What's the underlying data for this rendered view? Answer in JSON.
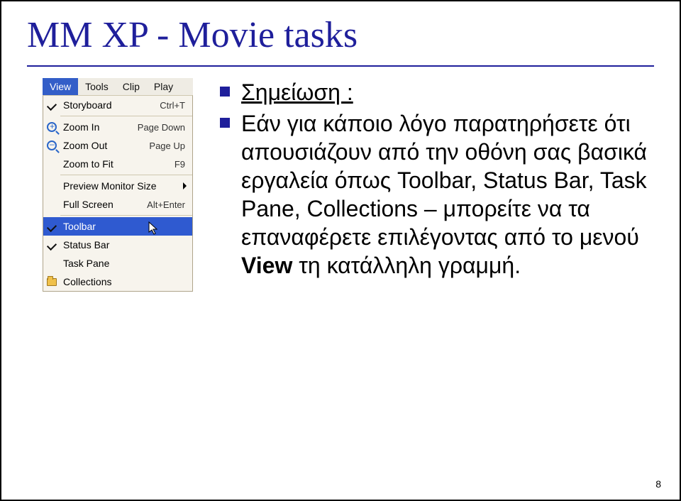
{
  "title": "ΜΜ XP - Movie tasks",
  "menubar": {
    "view": "View",
    "tools": "Tools",
    "clip": "Clip",
    "play": "Play"
  },
  "menu": {
    "storyboard": {
      "label": "Storyboard",
      "shortcut": "Ctrl+T"
    },
    "zoom_in": {
      "label": "Zoom In",
      "shortcut": "Page Down"
    },
    "zoom_out": {
      "label": "Zoom Out",
      "shortcut": "Page Up"
    },
    "zoom_fit": {
      "label": "Zoom to Fit",
      "shortcut": "F9"
    },
    "preview_size": {
      "label": "Preview Monitor Size",
      "shortcut": ""
    },
    "full_screen": {
      "label": "Full Screen",
      "shortcut": "Alt+Enter"
    },
    "toolbar": {
      "label": "Toolbar",
      "shortcut": ""
    },
    "status_bar": {
      "label": "Status Bar",
      "shortcut": ""
    },
    "task_pane": {
      "label": "Task Pane",
      "shortcut": ""
    },
    "collections": {
      "label": "Collections",
      "shortcut": ""
    }
  },
  "body": {
    "note_label": "Σημείωση :",
    "p1a": "Εάν για κάποιο λόγο παρατηρήσετε ότι απουσιάζουν από την οθόνη σας βασικά εργαλεία όπως Toolbar, Status Bar, Task Pane, Collections – μπορείτε να τα επαναφέρετε επιλέγοντας από το μενού ",
    "bold": "View",
    "p1b": " τη κατάλληλη γραμμή."
  },
  "page_number": "8"
}
